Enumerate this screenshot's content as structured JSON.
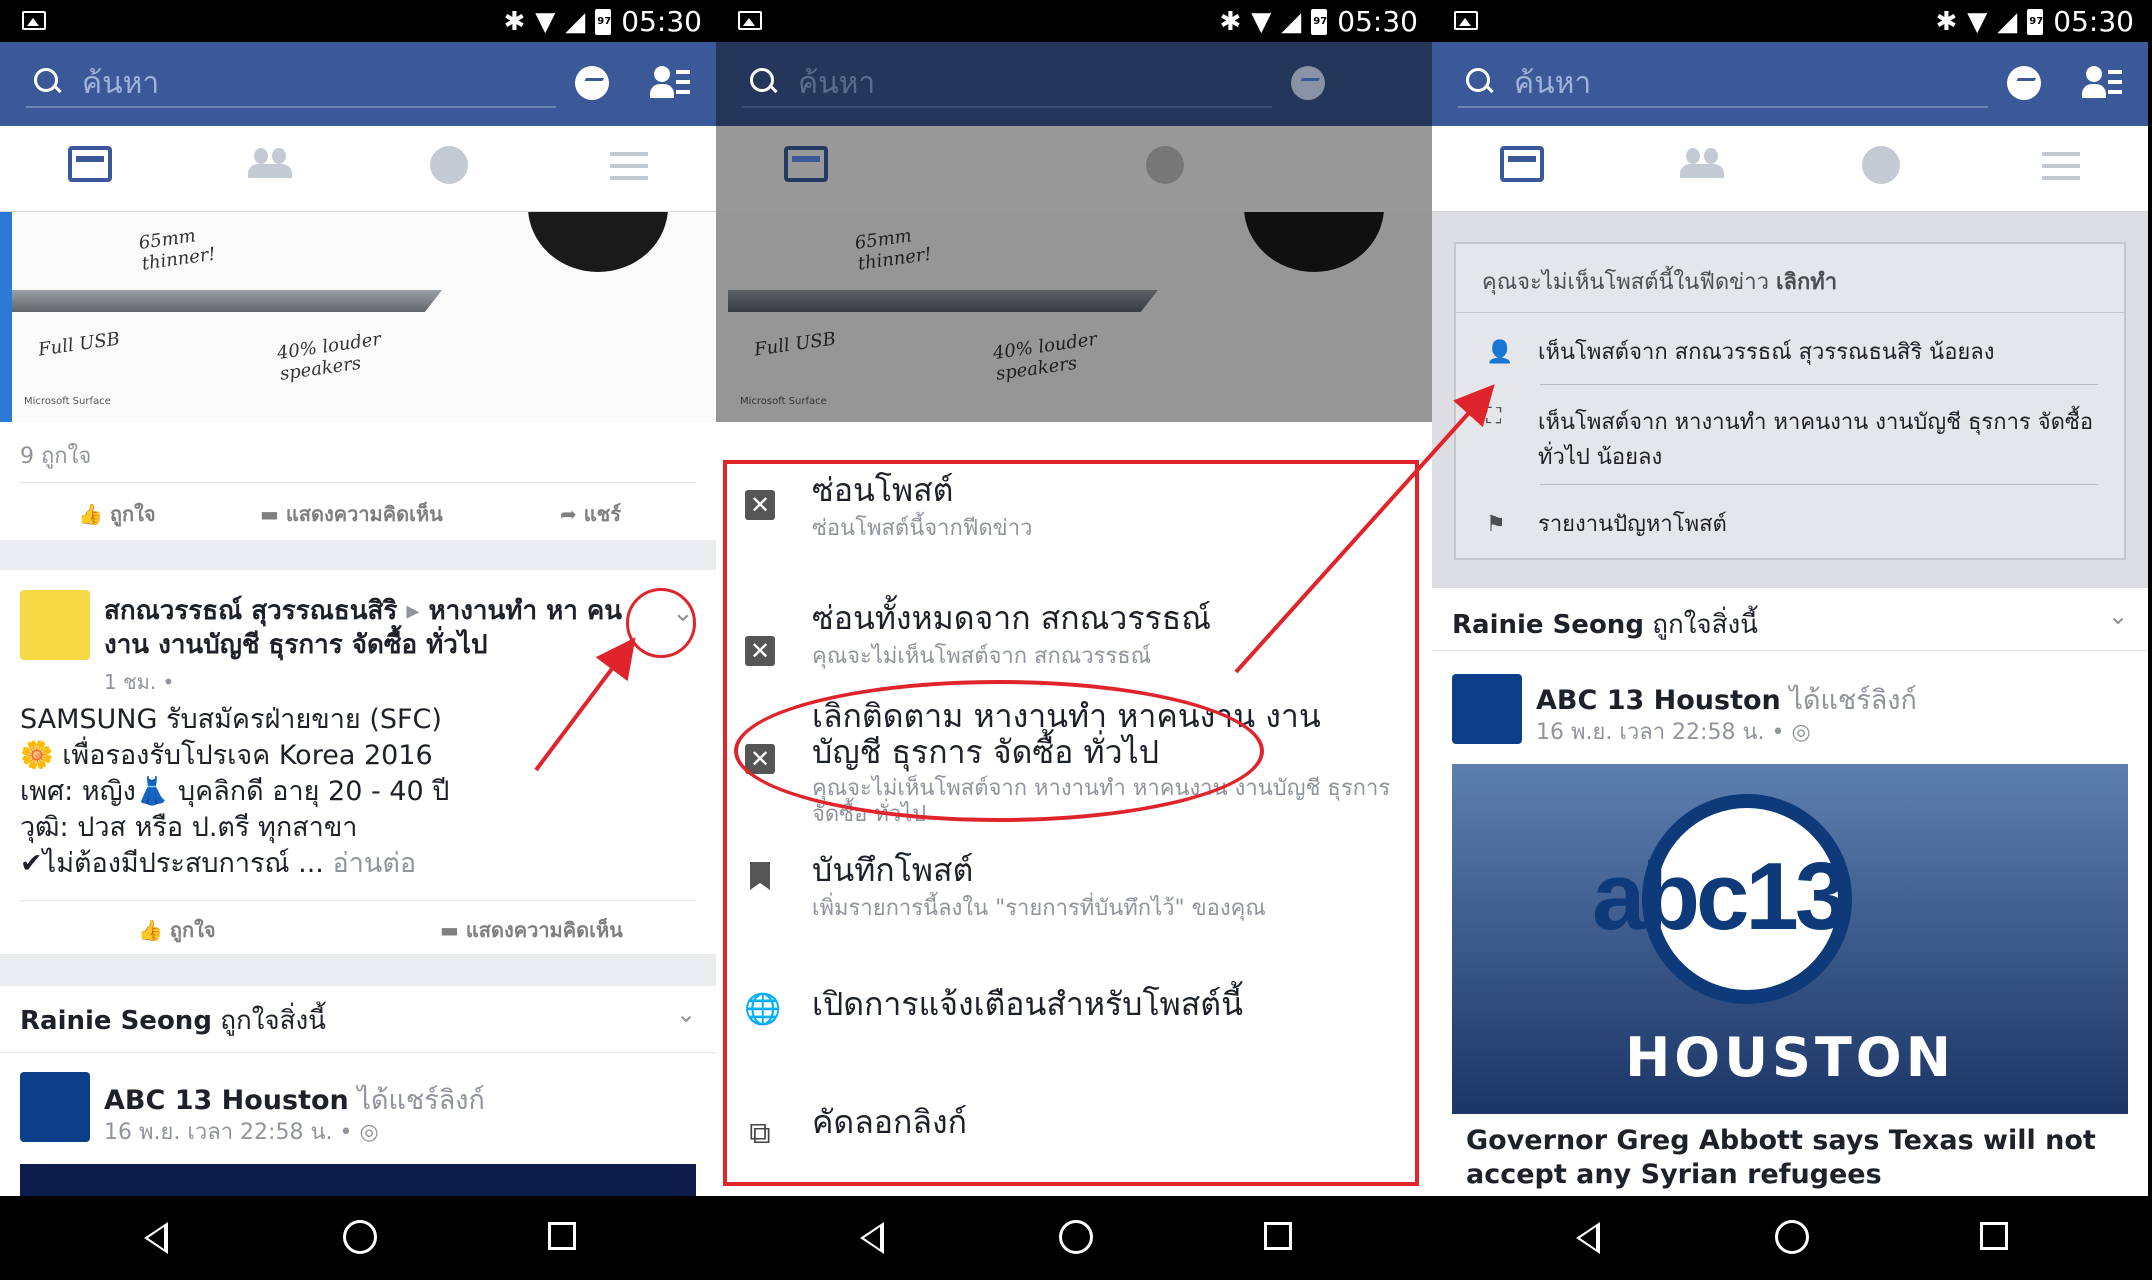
{
  "status": {
    "time": "05:30",
    "battery": "97"
  },
  "search": {
    "placeholder": "ค้นหา"
  },
  "panel1": {
    "image_text": {
      "thinner": "65mm thinner!",
      "usb": "Full USB",
      "speakers": "40% louder speakers",
      "brand": "Microsoft Surface"
    },
    "likes": "9 ถูกใจ",
    "actions": {
      "like": "ถูกใจ",
      "comment": "แสดงความคิดเห็น",
      "share": "แชร์"
    },
    "post": {
      "author": "สกณวรรธณ์ สุวรรณธนสิริ",
      "group": "หางานทำ หา คนงาน งานบัญชี ธุรการ จัดซื้อ ทั่วไป",
      "time": "1 ชม. •",
      "lines": [
        "SAMSUNG รับสมัครฝ่ายขาย (SFC)",
        "🌼 เพื่อรองรับโปรเจค Korea 2016",
        "เพศ: หญิง👗 บุคลิกดี อายุ 20 - 40 ปี",
        "วุฒิ: ปวส หรือ ป.ตรี ทุกสาขา",
        "✔ไม่ต้องมีประสบการณ์ ..."
      ],
      "read_more": "อ่านต่อ"
    },
    "actions2": {
      "like": "ถูกใจ",
      "comment": "แสดงความคิดเห็น"
    },
    "liked_header": {
      "name": "Rainie Seong",
      "text": "ถูกใจสิ่งนี้"
    },
    "share": {
      "page": "ABC 13 Houston",
      "verb": "ได้แชร์ลิงก์",
      "time": "16 พ.ย. เวลา 22:58 น. •"
    }
  },
  "panel2": {
    "menu": [
      {
        "icon": "close-box-icon",
        "title": "ซ่อนโพสต์",
        "sub": "ซ่อนโพสต์นี้จากฟีดข่าว"
      },
      {
        "icon": "trash-x-icon",
        "title": "ซ่อนทั้งหมดจาก สกณวรรธณ์",
        "sub": "คุณจะไม่เห็นโพสต์จาก สกณวรรธณ์"
      },
      {
        "icon": "trash-x-icon",
        "title": "เลิกติดตาม หางานทำ หาคนงาน งานบัญชี ธุรการ จัดซื้อ ทั่วไป",
        "sub": "คุณจะไม่เห็นโพสต์จาก หางานทำ หาคนงาน งานบัญชี ธุรการ จัดซื้อ ทั่วไป"
      },
      {
        "icon": "bookmark-icon",
        "title": "บันทึกโพสต์",
        "sub": "เพิ่มรายการนี้ลงใน \"รายการที่บันทึกไว้\" ของคุณ"
      },
      {
        "icon": "globe-icon",
        "title": "เปิดการแจ้งเตือนสำหรับโพสต์นี้",
        "sub": ""
      },
      {
        "icon": "copy-link-icon",
        "title": "คัดลอกลิงก์",
        "sub": ""
      }
    ]
  },
  "panel3": {
    "hidden_notice": "คุณจะไม่เห็นโพสต์นี้ในฟีดข่าว",
    "undo": "เลิกทำ",
    "options": [
      "เห็นโพสต์จาก สกณวรรธณ์ สุวรรณธนสิริ น้อยลง",
      "เห็นโพสต์จาก หางานทำ หาคนงาน งานบัญชี ธุรการ จัดซื้อ ทั่วไป น้อยลง",
      "รายงานปัญหาโพสต์"
    ],
    "liked_header": {
      "name": "Rainie Seong",
      "text": "ถูกใจสิ่งนี้"
    },
    "share": {
      "page": "ABC 13 Houston",
      "verb": "ได้แชร์ลิงก์",
      "time": "16 พ.ย. เวลา 22:58 น. •"
    },
    "image_text": {
      "logo": "abc13",
      "city": "HOUSTON"
    },
    "headline": "Governor Greg Abbott says Texas will not accept any Syrian refugees"
  },
  "colors": {
    "fb_blue": "#3b5998",
    "annotation_red": "#e0242b"
  }
}
